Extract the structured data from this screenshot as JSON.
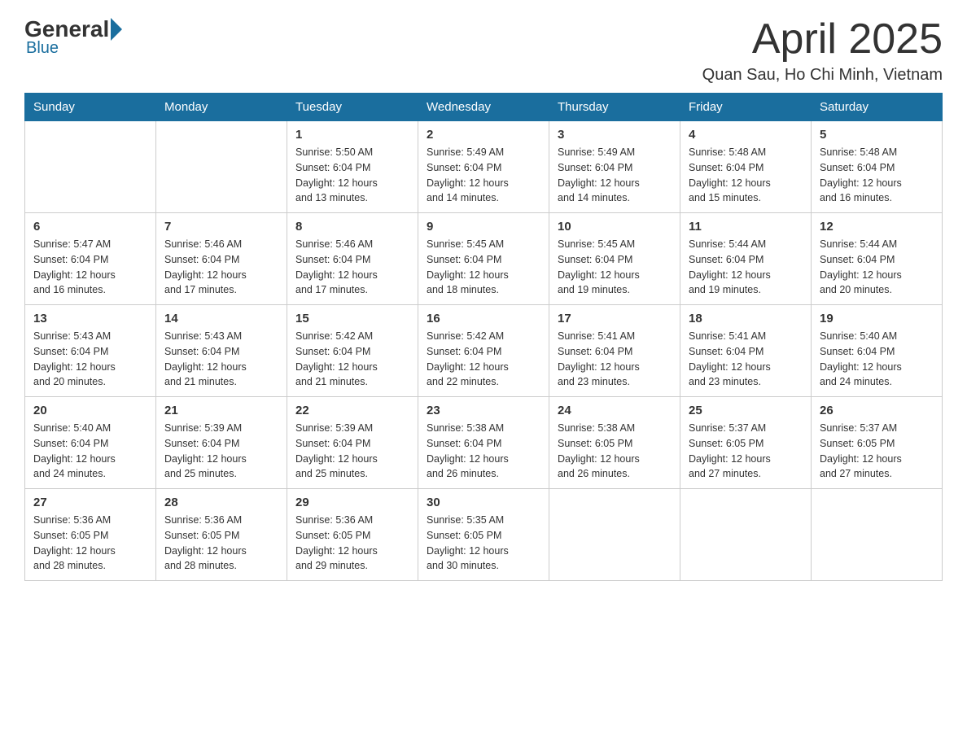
{
  "header": {
    "logo_general": "General",
    "logo_blue": "Blue",
    "title": "April 2025",
    "location": "Quan Sau, Ho Chi Minh, Vietnam"
  },
  "weekdays": [
    "Sunday",
    "Monday",
    "Tuesday",
    "Wednesday",
    "Thursday",
    "Friday",
    "Saturday"
  ],
  "weeks": [
    [
      {
        "day": "",
        "info": ""
      },
      {
        "day": "",
        "info": ""
      },
      {
        "day": "1",
        "info": "Sunrise: 5:50 AM\nSunset: 6:04 PM\nDaylight: 12 hours\nand 13 minutes."
      },
      {
        "day": "2",
        "info": "Sunrise: 5:49 AM\nSunset: 6:04 PM\nDaylight: 12 hours\nand 14 minutes."
      },
      {
        "day": "3",
        "info": "Sunrise: 5:49 AM\nSunset: 6:04 PM\nDaylight: 12 hours\nand 14 minutes."
      },
      {
        "day": "4",
        "info": "Sunrise: 5:48 AM\nSunset: 6:04 PM\nDaylight: 12 hours\nand 15 minutes."
      },
      {
        "day": "5",
        "info": "Sunrise: 5:48 AM\nSunset: 6:04 PM\nDaylight: 12 hours\nand 16 minutes."
      }
    ],
    [
      {
        "day": "6",
        "info": "Sunrise: 5:47 AM\nSunset: 6:04 PM\nDaylight: 12 hours\nand 16 minutes."
      },
      {
        "day": "7",
        "info": "Sunrise: 5:46 AM\nSunset: 6:04 PM\nDaylight: 12 hours\nand 17 minutes."
      },
      {
        "day": "8",
        "info": "Sunrise: 5:46 AM\nSunset: 6:04 PM\nDaylight: 12 hours\nand 17 minutes."
      },
      {
        "day": "9",
        "info": "Sunrise: 5:45 AM\nSunset: 6:04 PM\nDaylight: 12 hours\nand 18 minutes."
      },
      {
        "day": "10",
        "info": "Sunrise: 5:45 AM\nSunset: 6:04 PM\nDaylight: 12 hours\nand 19 minutes."
      },
      {
        "day": "11",
        "info": "Sunrise: 5:44 AM\nSunset: 6:04 PM\nDaylight: 12 hours\nand 19 minutes."
      },
      {
        "day": "12",
        "info": "Sunrise: 5:44 AM\nSunset: 6:04 PM\nDaylight: 12 hours\nand 20 minutes."
      }
    ],
    [
      {
        "day": "13",
        "info": "Sunrise: 5:43 AM\nSunset: 6:04 PM\nDaylight: 12 hours\nand 20 minutes."
      },
      {
        "day": "14",
        "info": "Sunrise: 5:43 AM\nSunset: 6:04 PM\nDaylight: 12 hours\nand 21 minutes."
      },
      {
        "day": "15",
        "info": "Sunrise: 5:42 AM\nSunset: 6:04 PM\nDaylight: 12 hours\nand 21 minutes."
      },
      {
        "day": "16",
        "info": "Sunrise: 5:42 AM\nSunset: 6:04 PM\nDaylight: 12 hours\nand 22 minutes."
      },
      {
        "day": "17",
        "info": "Sunrise: 5:41 AM\nSunset: 6:04 PM\nDaylight: 12 hours\nand 23 minutes."
      },
      {
        "day": "18",
        "info": "Sunrise: 5:41 AM\nSunset: 6:04 PM\nDaylight: 12 hours\nand 23 minutes."
      },
      {
        "day": "19",
        "info": "Sunrise: 5:40 AM\nSunset: 6:04 PM\nDaylight: 12 hours\nand 24 minutes."
      }
    ],
    [
      {
        "day": "20",
        "info": "Sunrise: 5:40 AM\nSunset: 6:04 PM\nDaylight: 12 hours\nand 24 minutes."
      },
      {
        "day": "21",
        "info": "Sunrise: 5:39 AM\nSunset: 6:04 PM\nDaylight: 12 hours\nand 25 minutes."
      },
      {
        "day": "22",
        "info": "Sunrise: 5:39 AM\nSunset: 6:04 PM\nDaylight: 12 hours\nand 25 minutes."
      },
      {
        "day": "23",
        "info": "Sunrise: 5:38 AM\nSunset: 6:04 PM\nDaylight: 12 hours\nand 26 minutes."
      },
      {
        "day": "24",
        "info": "Sunrise: 5:38 AM\nSunset: 6:05 PM\nDaylight: 12 hours\nand 26 minutes."
      },
      {
        "day": "25",
        "info": "Sunrise: 5:37 AM\nSunset: 6:05 PM\nDaylight: 12 hours\nand 27 minutes."
      },
      {
        "day": "26",
        "info": "Sunrise: 5:37 AM\nSunset: 6:05 PM\nDaylight: 12 hours\nand 27 minutes."
      }
    ],
    [
      {
        "day": "27",
        "info": "Sunrise: 5:36 AM\nSunset: 6:05 PM\nDaylight: 12 hours\nand 28 minutes."
      },
      {
        "day": "28",
        "info": "Sunrise: 5:36 AM\nSunset: 6:05 PM\nDaylight: 12 hours\nand 28 minutes."
      },
      {
        "day": "29",
        "info": "Sunrise: 5:36 AM\nSunset: 6:05 PM\nDaylight: 12 hours\nand 29 minutes."
      },
      {
        "day": "30",
        "info": "Sunrise: 5:35 AM\nSunset: 6:05 PM\nDaylight: 12 hours\nand 30 minutes."
      },
      {
        "day": "",
        "info": ""
      },
      {
        "day": "",
        "info": ""
      },
      {
        "day": "",
        "info": ""
      }
    ]
  ]
}
